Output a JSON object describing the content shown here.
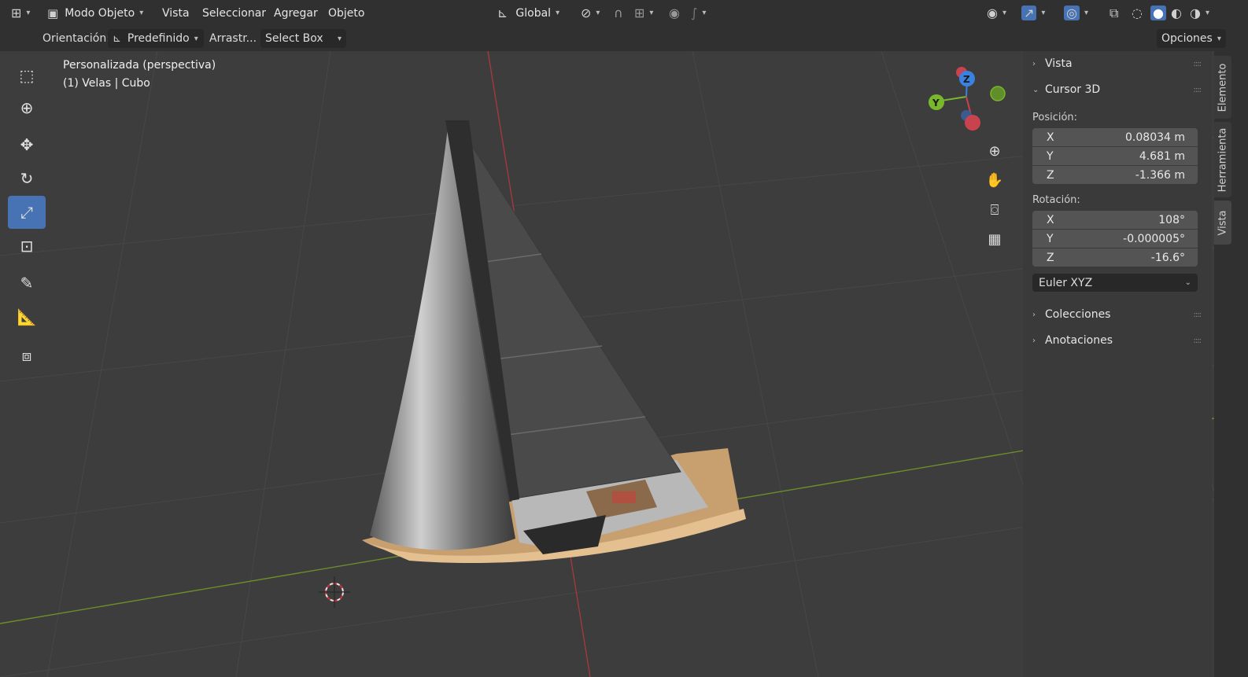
{
  "header": {
    "mode_label": "Modo Objeto",
    "menus": [
      "Vista",
      "Seleccionar",
      "Agregar",
      "Objeto"
    ],
    "transform_orientation": "Global"
  },
  "tool_header": {
    "orientation_label": "Orientación:",
    "orientation_value": "Predefinido",
    "drag_label": "Arrastr...",
    "drag_value": "Select Box",
    "options_label": "Opciones"
  },
  "viewport": {
    "view_name": "Personalizada (perspectiva)",
    "object_info": "(1) Velas | Cubo",
    "gizmo_axes": [
      "X",
      "Y",
      "Z"
    ]
  },
  "sidebar": {
    "panels": {
      "vista": "Vista",
      "cursor": "Cursor 3D",
      "colecciones": "Colecciones",
      "anotaciones": "Anotaciones"
    },
    "location_label": "Posición:",
    "location": [
      {
        "axis": "X",
        "value": "0.08034 m"
      },
      {
        "axis": "Y",
        "value": "4.681 m"
      },
      {
        "axis": "Z",
        "value": "-1.366 m"
      }
    ],
    "rotation_label": "Rotación:",
    "rotation": [
      {
        "axis": "X",
        "value": "108°"
      },
      {
        "axis": "Y",
        "value": "-0.000005°"
      },
      {
        "axis": "Z",
        "value": "-16.6°"
      }
    ],
    "rotation_mode": "Euler XYZ"
  },
  "tabs": [
    "Elemento",
    "Herramienta",
    "Vista"
  ],
  "colors": {
    "accent": "#4772b3",
    "axis_x": "#c8434d",
    "axis_y": "#79b82c",
    "axis_z": "#3b82e0"
  }
}
